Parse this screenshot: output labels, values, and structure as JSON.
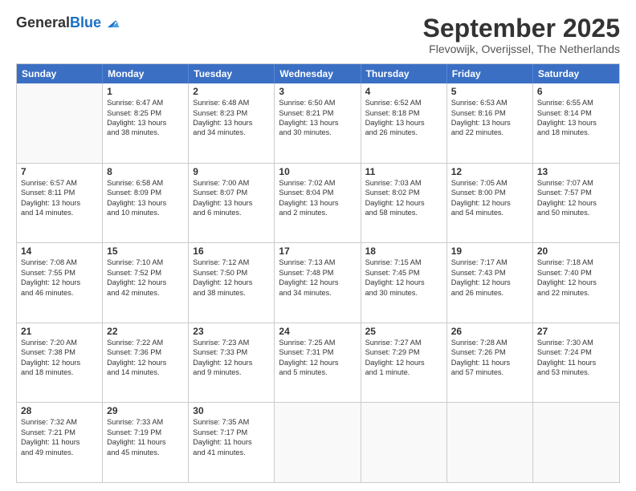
{
  "logo": {
    "general": "General",
    "blue": "Blue"
  },
  "header": {
    "title": "September 2025",
    "location": "Flevowijk, Overijssel, The Netherlands"
  },
  "weekdays": [
    "Sunday",
    "Monday",
    "Tuesday",
    "Wednesday",
    "Thursday",
    "Friday",
    "Saturday"
  ],
  "rows": [
    [
      {
        "day": "",
        "lines": []
      },
      {
        "day": "1",
        "lines": [
          "Sunrise: 6:47 AM",
          "Sunset: 8:25 PM",
          "Daylight: 13 hours",
          "and 38 minutes."
        ]
      },
      {
        "day": "2",
        "lines": [
          "Sunrise: 6:48 AM",
          "Sunset: 8:23 PM",
          "Daylight: 13 hours",
          "and 34 minutes."
        ]
      },
      {
        "day": "3",
        "lines": [
          "Sunrise: 6:50 AM",
          "Sunset: 8:21 PM",
          "Daylight: 13 hours",
          "and 30 minutes."
        ]
      },
      {
        "day": "4",
        "lines": [
          "Sunrise: 6:52 AM",
          "Sunset: 8:18 PM",
          "Daylight: 13 hours",
          "and 26 minutes."
        ]
      },
      {
        "day": "5",
        "lines": [
          "Sunrise: 6:53 AM",
          "Sunset: 8:16 PM",
          "Daylight: 13 hours",
          "and 22 minutes."
        ]
      },
      {
        "day": "6",
        "lines": [
          "Sunrise: 6:55 AM",
          "Sunset: 8:14 PM",
          "Daylight: 13 hours",
          "and 18 minutes."
        ]
      }
    ],
    [
      {
        "day": "7",
        "lines": [
          "Sunrise: 6:57 AM",
          "Sunset: 8:11 PM",
          "Daylight: 13 hours",
          "and 14 minutes."
        ]
      },
      {
        "day": "8",
        "lines": [
          "Sunrise: 6:58 AM",
          "Sunset: 8:09 PM",
          "Daylight: 13 hours",
          "and 10 minutes."
        ]
      },
      {
        "day": "9",
        "lines": [
          "Sunrise: 7:00 AM",
          "Sunset: 8:07 PM",
          "Daylight: 13 hours",
          "and 6 minutes."
        ]
      },
      {
        "day": "10",
        "lines": [
          "Sunrise: 7:02 AM",
          "Sunset: 8:04 PM",
          "Daylight: 13 hours",
          "and 2 minutes."
        ]
      },
      {
        "day": "11",
        "lines": [
          "Sunrise: 7:03 AM",
          "Sunset: 8:02 PM",
          "Daylight: 12 hours",
          "and 58 minutes."
        ]
      },
      {
        "day": "12",
        "lines": [
          "Sunrise: 7:05 AM",
          "Sunset: 8:00 PM",
          "Daylight: 12 hours",
          "and 54 minutes."
        ]
      },
      {
        "day": "13",
        "lines": [
          "Sunrise: 7:07 AM",
          "Sunset: 7:57 PM",
          "Daylight: 12 hours",
          "and 50 minutes."
        ]
      }
    ],
    [
      {
        "day": "14",
        "lines": [
          "Sunrise: 7:08 AM",
          "Sunset: 7:55 PM",
          "Daylight: 12 hours",
          "and 46 minutes."
        ]
      },
      {
        "day": "15",
        "lines": [
          "Sunrise: 7:10 AM",
          "Sunset: 7:52 PM",
          "Daylight: 12 hours",
          "and 42 minutes."
        ]
      },
      {
        "day": "16",
        "lines": [
          "Sunrise: 7:12 AM",
          "Sunset: 7:50 PM",
          "Daylight: 12 hours",
          "and 38 minutes."
        ]
      },
      {
        "day": "17",
        "lines": [
          "Sunrise: 7:13 AM",
          "Sunset: 7:48 PM",
          "Daylight: 12 hours",
          "and 34 minutes."
        ]
      },
      {
        "day": "18",
        "lines": [
          "Sunrise: 7:15 AM",
          "Sunset: 7:45 PM",
          "Daylight: 12 hours",
          "and 30 minutes."
        ]
      },
      {
        "day": "19",
        "lines": [
          "Sunrise: 7:17 AM",
          "Sunset: 7:43 PM",
          "Daylight: 12 hours",
          "and 26 minutes."
        ]
      },
      {
        "day": "20",
        "lines": [
          "Sunrise: 7:18 AM",
          "Sunset: 7:40 PM",
          "Daylight: 12 hours",
          "and 22 minutes."
        ]
      }
    ],
    [
      {
        "day": "21",
        "lines": [
          "Sunrise: 7:20 AM",
          "Sunset: 7:38 PM",
          "Daylight: 12 hours",
          "and 18 minutes."
        ]
      },
      {
        "day": "22",
        "lines": [
          "Sunrise: 7:22 AM",
          "Sunset: 7:36 PM",
          "Daylight: 12 hours",
          "and 14 minutes."
        ]
      },
      {
        "day": "23",
        "lines": [
          "Sunrise: 7:23 AM",
          "Sunset: 7:33 PM",
          "Daylight: 12 hours",
          "and 9 minutes."
        ]
      },
      {
        "day": "24",
        "lines": [
          "Sunrise: 7:25 AM",
          "Sunset: 7:31 PM",
          "Daylight: 12 hours",
          "and 5 minutes."
        ]
      },
      {
        "day": "25",
        "lines": [
          "Sunrise: 7:27 AM",
          "Sunset: 7:29 PM",
          "Daylight: 12 hours",
          "and 1 minute."
        ]
      },
      {
        "day": "26",
        "lines": [
          "Sunrise: 7:28 AM",
          "Sunset: 7:26 PM",
          "Daylight: 11 hours",
          "and 57 minutes."
        ]
      },
      {
        "day": "27",
        "lines": [
          "Sunrise: 7:30 AM",
          "Sunset: 7:24 PM",
          "Daylight: 11 hours",
          "and 53 minutes."
        ]
      }
    ],
    [
      {
        "day": "28",
        "lines": [
          "Sunrise: 7:32 AM",
          "Sunset: 7:21 PM",
          "Daylight: 11 hours",
          "and 49 minutes."
        ]
      },
      {
        "day": "29",
        "lines": [
          "Sunrise: 7:33 AM",
          "Sunset: 7:19 PM",
          "Daylight: 11 hours",
          "and 45 minutes."
        ]
      },
      {
        "day": "30",
        "lines": [
          "Sunrise: 7:35 AM",
          "Sunset: 7:17 PM",
          "Daylight: 11 hours",
          "and 41 minutes."
        ]
      },
      {
        "day": "",
        "lines": []
      },
      {
        "day": "",
        "lines": []
      },
      {
        "day": "",
        "lines": []
      },
      {
        "day": "",
        "lines": []
      }
    ]
  ]
}
